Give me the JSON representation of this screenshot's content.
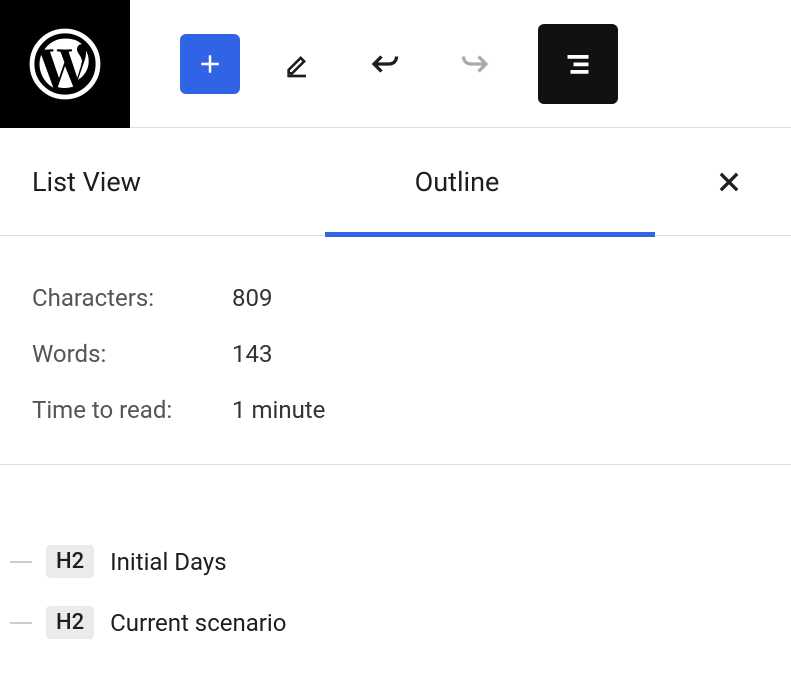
{
  "tabs": {
    "list_view": "List View",
    "outline": "Outline"
  },
  "stats": {
    "characters_label": "Characters:",
    "characters_value": "809",
    "words_label": "Words:",
    "words_value": "143",
    "time_label": "Time to read:",
    "time_value": "1 minute"
  },
  "outline": [
    {
      "level": "H2",
      "title": "Initial Days"
    },
    {
      "level": "H2",
      "title": "Current scenario"
    }
  ]
}
